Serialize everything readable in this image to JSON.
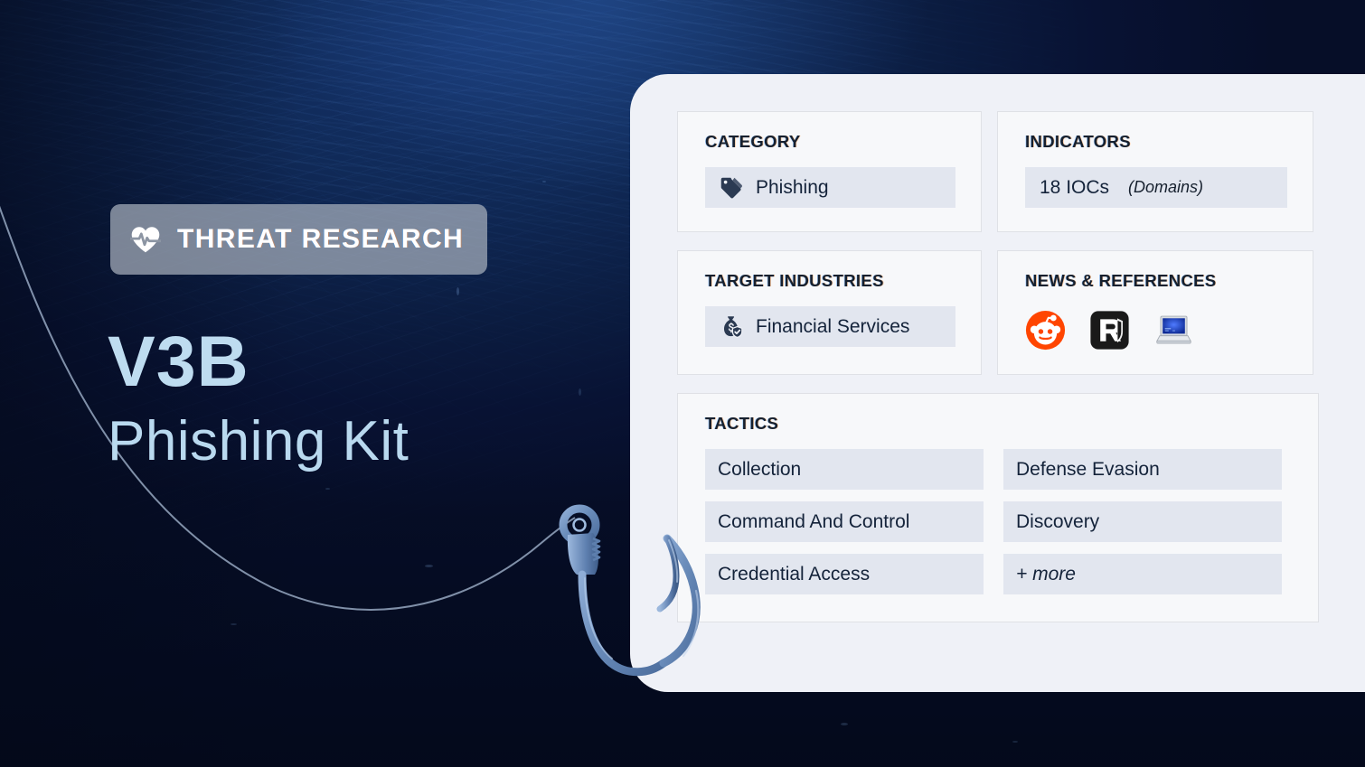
{
  "hero": {
    "badge_label": "THREAT RESEARCH",
    "badge_icon": "heart-pulse-icon",
    "title": "V3B",
    "subtitle": "Phishing Kit"
  },
  "panel": {
    "cards": {
      "category": {
        "title": "CATEGORY",
        "value": "Phishing",
        "icon": "tag-icon"
      },
      "indicators": {
        "title": "INDICATORS",
        "value": "18 IOCs",
        "value_note": "(Domains)"
      },
      "target_industries": {
        "title": "TARGET INDUSTRIES",
        "value": "Financial Services",
        "icon": "money-bag-shield-icon"
      },
      "news_references": {
        "title": "NEWS & REFERENCES",
        "icons": [
          "reddit-icon",
          "resecurity-icon",
          "laptop-icon"
        ]
      },
      "tactics": {
        "title": "TACTICS",
        "items": [
          "Collection",
          "Defense Evasion",
          "Command And Control",
          "Discovery",
          "Credential Access",
          "+ more"
        ]
      }
    }
  },
  "colors": {
    "ocean_deep": "#060e28",
    "ocean_mid": "#102a58",
    "hero_text": "#bedcf0",
    "panel_bg": "#eff1f7",
    "card_bg": "#f7f8fa",
    "chip_bg": "#e2e6ef",
    "hook_blue": "#6688bb",
    "reddit_orange": "#ff4500",
    "resecurity_black": "#1a1a1a"
  }
}
